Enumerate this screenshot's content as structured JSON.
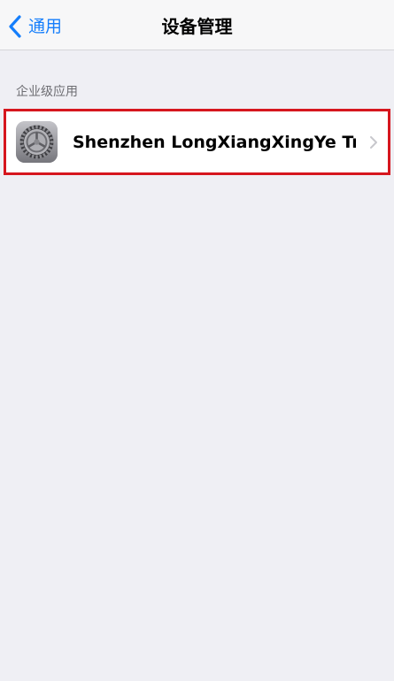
{
  "navbar": {
    "back_label": "通用",
    "title": "设备管理",
    "back_icon": "chevron-left-icon",
    "accent_color": "#157efb"
  },
  "section": {
    "header": "企业级应用",
    "items": [
      {
        "label": "Shenzhen LongXiangXingYe Trad...",
        "icon": "settings-gear-icon",
        "disclosure_icon": "chevron-right-icon"
      }
    ]
  },
  "highlight_color": "#d6161e"
}
